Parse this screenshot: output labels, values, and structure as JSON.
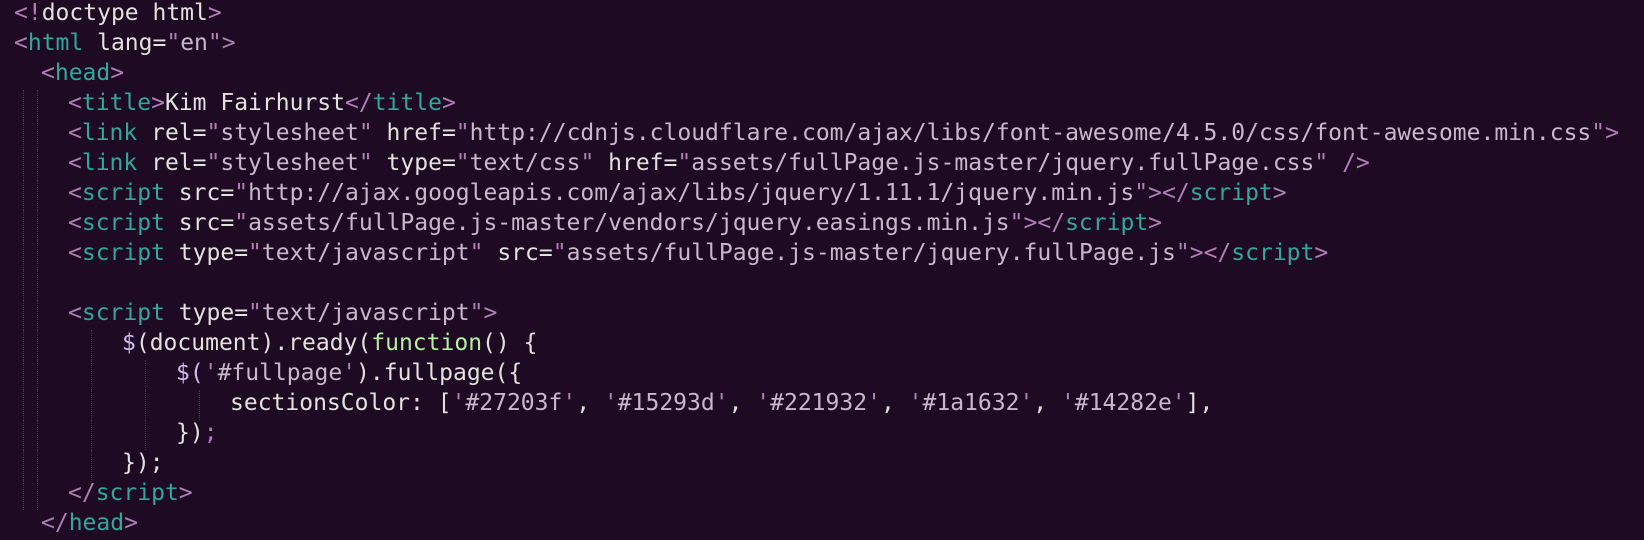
{
  "editor": {
    "language": "html",
    "theme": {
      "background": "#1e0a22",
      "punctuation": "#b07fb6",
      "tag": "#31a89c",
      "text": "#e2e2dc",
      "string": "#c9b7cc",
      "function": "#b4ef9e"
    },
    "lines": [
      {
        "indent": 0,
        "tokens": [
          {
            "t": "<!",
            "k": "punct"
          },
          {
            "t": "doctype html",
            "k": "text"
          },
          {
            "t": ">",
            "k": "punct"
          }
        ]
      },
      {
        "indent": 0,
        "tokens": [
          {
            "t": "<",
            "k": "punct"
          },
          {
            "t": "html",
            "k": "tag"
          },
          {
            "t": " lang=",
            "k": "attr"
          },
          {
            "t": "\"",
            "k": "string"
          },
          {
            "t": "en",
            "k": "strbody"
          },
          {
            "t": "\"",
            "k": "string"
          },
          {
            "t": ">",
            "k": "punct"
          }
        ]
      },
      {
        "indent": 1,
        "tokens": [
          {
            "t": "<",
            "k": "punct"
          },
          {
            "t": "head",
            "k": "tag"
          },
          {
            "t": ">",
            "k": "punct"
          }
        ]
      },
      {
        "indent": 2,
        "tokens": [
          {
            "t": "<",
            "k": "punct"
          },
          {
            "t": "title",
            "k": "tag"
          },
          {
            "t": ">",
            "k": "punct"
          },
          {
            "t": "Kim Fairhurst",
            "k": "text"
          },
          {
            "t": "</",
            "k": "punct"
          },
          {
            "t": "title",
            "k": "tag"
          },
          {
            "t": ">",
            "k": "punct"
          }
        ]
      },
      {
        "indent": 2,
        "tokens": [
          {
            "t": "<",
            "k": "punct"
          },
          {
            "t": "link",
            "k": "tag"
          },
          {
            "t": " rel=",
            "k": "attr"
          },
          {
            "t": "\"",
            "k": "string"
          },
          {
            "t": "stylesheet",
            "k": "strbody"
          },
          {
            "t": "\"",
            "k": "string"
          },
          {
            "t": " href=",
            "k": "attr"
          },
          {
            "t": "\"",
            "k": "string"
          },
          {
            "t": "http://cdnjs.cloudflare.com/ajax/libs/font-awesome/4.5.0/css/font-awesome.min.css",
            "k": "strbody"
          },
          {
            "t": "\"",
            "k": "string"
          },
          {
            "t": ">",
            "k": "punct"
          }
        ]
      },
      {
        "indent": 2,
        "tokens": [
          {
            "t": "<",
            "k": "punct"
          },
          {
            "t": "link",
            "k": "tag"
          },
          {
            "t": " rel=",
            "k": "attr"
          },
          {
            "t": "\"",
            "k": "string"
          },
          {
            "t": "stylesheet",
            "k": "strbody"
          },
          {
            "t": "\"",
            "k": "string"
          },
          {
            "t": " type=",
            "k": "attr"
          },
          {
            "t": "\"",
            "k": "string"
          },
          {
            "t": "text/css",
            "k": "strbody"
          },
          {
            "t": "\"",
            "k": "string"
          },
          {
            "t": " href=",
            "k": "attr"
          },
          {
            "t": "\"",
            "k": "string"
          },
          {
            "t": "assets/fullPage.js-master/jquery.fullPage.css",
            "k": "strbody"
          },
          {
            "t": "\"",
            "k": "string"
          },
          {
            "t": " />",
            "k": "punct"
          }
        ]
      },
      {
        "indent": 2,
        "tokens": [
          {
            "t": "<",
            "k": "punct"
          },
          {
            "t": "script",
            "k": "tag"
          },
          {
            "t": " src=",
            "k": "attr"
          },
          {
            "t": "\"",
            "k": "string"
          },
          {
            "t": "http://ajax.googleapis.com/ajax/libs/jquery/1.11.1/jquery.min.js",
            "k": "strbody"
          },
          {
            "t": "\"",
            "k": "string"
          },
          {
            "t": "></",
            "k": "punct"
          },
          {
            "t": "script",
            "k": "tag"
          },
          {
            "t": ">",
            "k": "punct"
          }
        ]
      },
      {
        "indent": 2,
        "tokens": [
          {
            "t": "<",
            "k": "punct"
          },
          {
            "t": "script",
            "k": "tag"
          },
          {
            "t": " src=",
            "k": "attr"
          },
          {
            "t": "\"",
            "k": "string"
          },
          {
            "t": "assets/fullPage.js-master/vendors/jquery.easings.min.js",
            "k": "strbody"
          },
          {
            "t": "\"",
            "k": "string"
          },
          {
            "t": "></",
            "k": "punct"
          },
          {
            "t": "script",
            "k": "tag"
          },
          {
            "t": ">",
            "k": "punct"
          }
        ]
      },
      {
        "indent": 2,
        "tokens": [
          {
            "t": "<",
            "k": "punct"
          },
          {
            "t": "script",
            "k": "tag"
          },
          {
            "t": " type=",
            "k": "attr"
          },
          {
            "t": "\"",
            "k": "string"
          },
          {
            "t": "text/javascript",
            "k": "strbody"
          },
          {
            "t": "\"",
            "k": "string"
          },
          {
            "t": " src=",
            "k": "attr"
          },
          {
            "t": "\"",
            "k": "string"
          },
          {
            "t": "assets/fullPage.js-master/jquery.fullPage.js",
            "k": "strbody"
          },
          {
            "t": "\"",
            "k": "string"
          },
          {
            "t": "></",
            "k": "punct"
          },
          {
            "t": "script",
            "k": "tag"
          },
          {
            "t": ">",
            "k": "punct"
          }
        ]
      },
      {
        "indent": 2,
        "tokens": []
      },
      {
        "indent": 2,
        "tokens": [
          {
            "t": "<",
            "k": "punct"
          },
          {
            "t": "script",
            "k": "tag"
          },
          {
            "t": " type=",
            "k": "attr"
          },
          {
            "t": "\"",
            "k": "string"
          },
          {
            "t": "text/javascript",
            "k": "strbody"
          },
          {
            "t": "\"",
            "k": "string"
          },
          {
            "t": ">",
            "k": "punct"
          }
        ]
      },
      {
        "indent": 4,
        "tokens": [
          {
            "t": "$",
            "k": "id"
          },
          {
            "t": "(document).ready(",
            "k": "text"
          },
          {
            "t": "function",
            "k": "func"
          },
          {
            "t": "() {",
            "k": "text"
          }
        ]
      },
      {
        "indent": 6,
        "tokens": [
          {
            "t": "$(",
            "k": "id"
          },
          {
            "t": "'",
            "k": "string"
          },
          {
            "t": "#fullpage",
            "k": "strbody"
          },
          {
            "t": "'",
            "k": "string"
          },
          {
            "t": ").fullpage({",
            "k": "text"
          }
        ]
      },
      {
        "indent": 8,
        "tokens": [
          {
            "t": "sectionsColor: [",
            "k": "text"
          },
          {
            "t": "'",
            "k": "string"
          },
          {
            "t": "#27203f",
            "k": "strbody"
          },
          {
            "t": "'",
            "k": "string"
          },
          {
            "t": ", ",
            "k": "text"
          },
          {
            "t": "'",
            "k": "string"
          },
          {
            "t": "#15293d",
            "k": "strbody"
          },
          {
            "t": "'",
            "k": "string"
          },
          {
            "t": ", ",
            "k": "text"
          },
          {
            "t": "'",
            "k": "string"
          },
          {
            "t": "#221932",
            "k": "strbody"
          },
          {
            "t": "'",
            "k": "string"
          },
          {
            "t": ", ",
            "k": "text"
          },
          {
            "t": "'",
            "k": "string"
          },
          {
            "t": "#1a1632",
            "k": "strbody"
          },
          {
            "t": "'",
            "k": "string"
          },
          {
            "t": ", ",
            "k": "text"
          },
          {
            "t": "'",
            "k": "string"
          },
          {
            "t": "#14282e",
            "k": "strbody"
          },
          {
            "t": "'",
            "k": "string"
          },
          {
            "t": "],",
            "k": "text"
          }
        ]
      },
      {
        "indent": 6,
        "tokens": [
          {
            "t": "})",
            "k": "text"
          },
          {
            "t": ";",
            "k": "punct"
          }
        ]
      },
      {
        "indent": 4,
        "tokens": [
          {
            "t": "});",
            "k": "text"
          }
        ]
      },
      {
        "indent": 2,
        "tokens": [
          {
            "t": "</",
            "k": "punct"
          },
          {
            "t": "script",
            "k": "tag"
          },
          {
            "t": ">",
            "k": "punct"
          }
        ]
      },
      {
        "indent": 1,
        "tokens": [
          {
            "t": "</",
            "k": "punct"
          },
          {
            "t": "head",
            "k": "tag"
          },
          {
            "t": ">",
            "k": "punct"
          }
        ]
      }
    ]
  }
}
